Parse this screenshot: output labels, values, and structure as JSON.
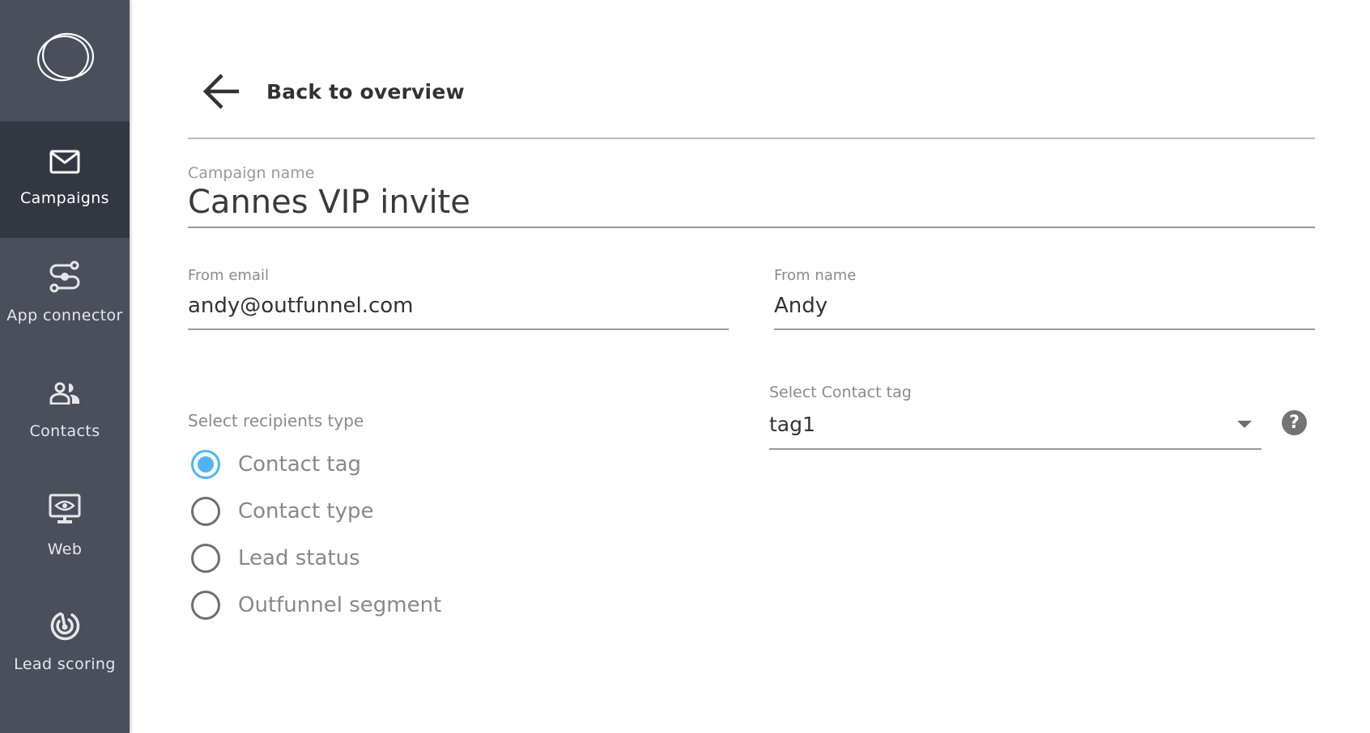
{
  "sidebar": {
    "logo": "outfunnel-logo",
    "active_index": 0,
    "items": [
      {
        "label": "Campaigns",
        "icon": "envelope-icon"
      },
      {
        "label": "App connector",
        "icon": "connector-icon"
      },
      {
        "label": "Contacts",
        "icon": "contacts-icon"
      },
      {
        "label": "Web",
        "icon": "monitor-eye-icon"
      },
      {
        "label": "Lead scoring",
        "icon": "target-icon"
      }
    ]
  },
  "header": {
    "back_label": "Back to overview",
    "back_icon": "arrow-left-icon"
  },
  "form": {
    "campaign_name": {
      "label": "Campaign name",
      "value": "Cannes VIP invite"
    },
    "from_email": {
      "label": "From email",
      "value": "andy@outfunnel.com"
    },
    "from_name": {
      "label": "From name",
      "value": "Andy"
    },
    "recipients": {
      "label": "Select recipients type",
      "selected_index": 0,
      "options": [
        "Contact tag",
        "Contact type",
        "Lead status",
        "Outfunnel segment"
      ]
    },
    "contact_tag": {
      "label": "Select Contact tag",
      "value": "tag1",
      "help_icon": "question-circle-icon",
      "help_symbol": "?"
    }
  },
  "colors": {
    "sidebar_bg": "#4a4f5c",
    "sidebar_active_bg": "#333741",
    "accent": "#4fb5f5"
  }
}
